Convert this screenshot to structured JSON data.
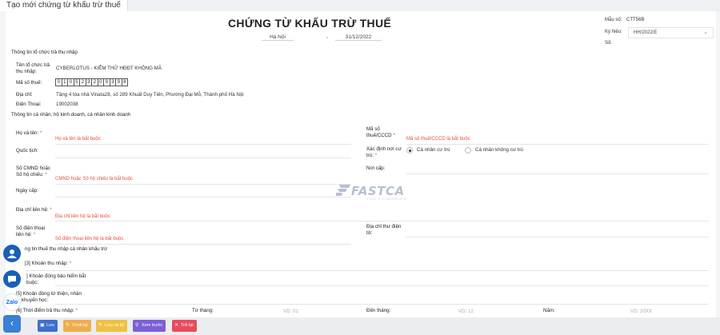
{
  "tab": {
    "title": "Tạo mới chứng từ khấu trừ thuế"
  },
  "doc": {
    "title": "CHỨNG TỪ KHẤU TRỪ THUẾ",
    "place": "Hà Nội",
    "comma": ",",
    "date": "31/12/2022",
    "template_label": "Mẫu số:",
    "template_value": "CTT56B",
    "symbol_label": "Ký hiệu:",
    "symbol_value": "HH/2022/E",
    "number_label": "Số:"
  },
  "payer": {
    "section": "Thông tin tổ chức trả thu nhập",
    "name_label": "Tên tổ chức trả thu nhập:",
    "name_value": "CYBERLOTUS - KIỂM THỬ HĐĐT KHÔNG MÃ",
    "taxcode_label": "Mã số thuế:",
    "taxcode_digits": [
      "0",
      "1",
      "0",
      "5",
      "2",
      "3",
      "2",
      "0",
      "9",
      "3",
      "9",
      "8"
    ],
    "address_label": "Địa chỉ:",
    "address_value": "Tầng 4 tòa nhà Vinata28, số 289 Khuất Duy Tiến, Phường Đại Mỗ, Thành phố Hà Nội",
    "phone_label": "Điện Thoại:",
    "phone_value": "19002038"
  },
  "person": {
    "section": "Thông tin cá nhân, hộ kinh doanh, cá nhân kinh doanh",
    "fullname_label": "Họ và tên:",
    "fullname_error": "Họ và tên là bắt buộc",
    "taxid_label": "Mã số thuế/CCCD",
    "taxid_error": "Mã số thuế/CCCD là bắt buộc",
    "nationality_label": "Quốc tịch:",
    "residence_label": "Xác định nơi cư trú:",
    "resident_option": "Cá nhân cư trú",
    "nonresident_option": "Cá nhân không cư trú",
    "id_label": "Số CMND hoặc Số hộ chiếu:",
    "id_error": "CMND hoặc Số hộ chiếu là bắt buộc",
    "issue_place_label": "Nơi cấp:",
    "issue_date_label": "Ngày cấp:",
    "contact_address_label": "Địa chỉ liên hệ:",
    "contact_address_error": "Địa chỉ liên hệ là bắt buộc",
    "phone_label": "Số điện thoại liên hệ:",
    "phone_error": "Số điện thoại liên hệ là bắt buộc",
    "email_label": "Địa chỉ thư điện tử:"
  },
  "tax": {
    "section": "ng tin thuế thu nhập cá nhân khấu trừ",
    "income_label": "[3] Khoản thu nhập:",
    "insurance_label_1": "] Khoản đóng bảo hiểm bắt",
    "insurance_label_2": "buộc:",
    "charity_label_1": "[5] Khoản đóng từ thiện, nhân",
    "charity_label_2": "o, khuyến học:",
    "period_label": "[6] Thời điểm trả thu nhập:",
    "from_month_label": "Từ tháng:",
    "from_month_placeholder": "VD: 01",
    "to_month_label": "Đến tháng:",
    "to_month_placeholder": "VD: 12",
    "year_label": "Năm:",
    "year_placeholder": "VD: 20XX",
    "required_mark": "*"
  },
  "watermark": {
    "brand": "FASTCA",
    "tagline": "FAST & CONVENIENT"
  },
  "floating": {
    "zalo_label": "Zalo"
  },
  "toolbar": {
    "save": "Lưu",
    "sign": "Trình ký",
    "save_sign": "Lưu và ký",
    "preview": "Xem trước",
    "back": "Trở lại"
  },
  "colors": {
    "error": "#e74c3c",
    "save": "#3f6fcf",
    "sign": "#f0ad4e",
    "save_sign": "#f0c040",
    "preview": "#7c5fd6",
    "back": "#e74c5e"
  }
}
